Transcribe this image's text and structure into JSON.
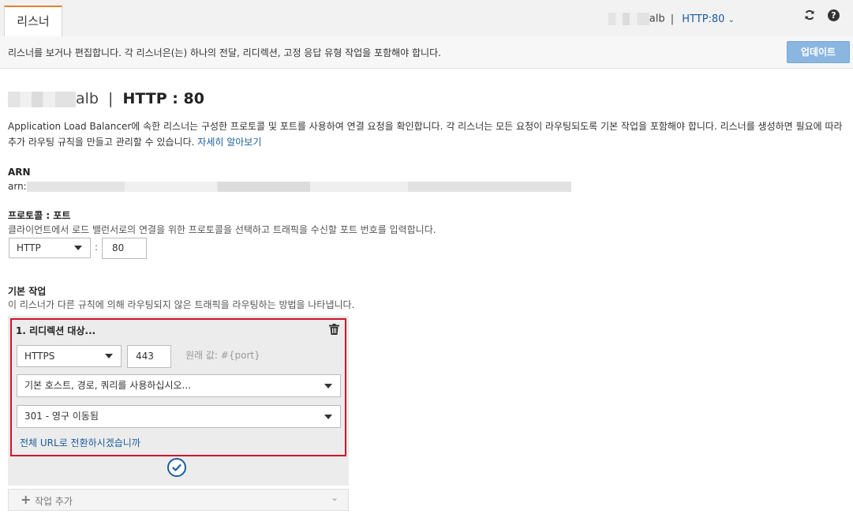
{
  "tabs": [
    {
      "label": "리스너"
    }
  ],
  "top": {
    "lb_name": "alb",
    "separator": "|",
    "listener_link": "HTTP:80",
    "refresh_icon": "refresh-icon",
    "help_icon": "help-icon"
  },
  "descbar": {
    "text": "리스너를 보거나 편집합니다. 각 리스너은(는) 하나의 전달, 리디렉션, 고정 응답 유형 작업을 포함해야 합니다.",
    "update_button": "업데이트"
  },
  "heading": {
    "lb_name": "alb",
    "separator": "|",
    "listener": "HTTP : 80"
  },
  "intro": {
    "text": "Application Load Balancer에 속한 리스너는 구성한 프로토콜 및 포트를 사용하여 연결 요청을 확인합니다. 각 리스너는 모든 요청이 라우팅되도록 기본 작업을 포함해야 합니다. 리스너를 생성하면 필요에 따라 추가 라우팅 규칙을 만들고 관리할 수 있습니다.",
    "learn_more": "자세히 알아보기"
  },
  "arn": {
    "label": "ARN",
    "prefix": "arn:"
  },
  "protocol_port": {
    "label": "프로토콜 : 포트",
    "description": "클라이언트에서 로드 밸런서로의 연결을 위한 프로토콜을 선택하고 트래픽을 수신할 포트 번호를 입력합니다.",
    "protocol": "HTTP",
    "colon": ":",
    "port": "80"
  },
  "default_action": {
    "label": "기본 작업",
    "description": "이 리스너가 다른 규칙에 의해 라우팅되지 않은 트래픽을 라우팅하는 방법을 나타냅니다.",
    "action_title": "1. 리디렉션 대상...",
    "redirect_protocol": "HTTPS",
    "redirect_port": "443",
    "original_value_hint": "원래 값: #{port}",
    "host_path_query": "기본 호스트, 경로, 쿼리를 사용하십시오...",
    "status_code": "301 - 영구 이동됨",
    "switch_full_url": "전체 URL로 전환하시겠습니까",
    "add_action": "작업 추가"
  },
  "colors": {
    "accent_orange": "#e7822a",
    "link_blue": "#1a5d9c",
    "highlight_red": "#d0142b",
    "update_button_bg": "#8ab6e0"
  }
}
